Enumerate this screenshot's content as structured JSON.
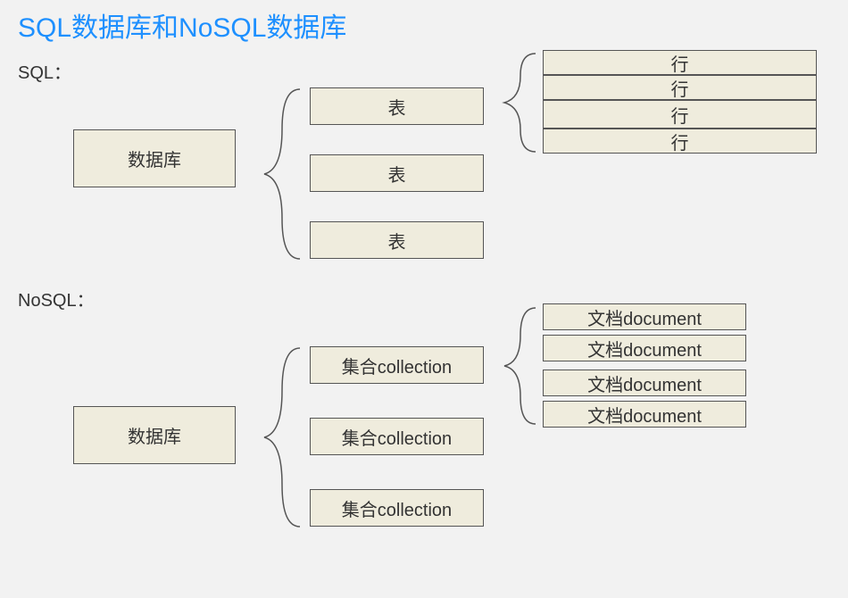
{
  "title": "SQL数据库和NoSQL数据库",
  "sql": {
    "label": "SQL：",
    "db": "数据库",
    "tables": [
      "表",
      "表",
      "表"
    ],
    "rows": [
      "行",
      "行",
      "行",
      "行"
    ]
  },
  "nosql": {
    "label": "NoSQL：",
    "db": "数据库",
    "collections": [
      "集合collection",
      "集合collection",
      "集合collection"
    ],
    "documents": [
      "文档document",
      "文档document",
      "文档document",
      "文档document"
    ]
  }
}
